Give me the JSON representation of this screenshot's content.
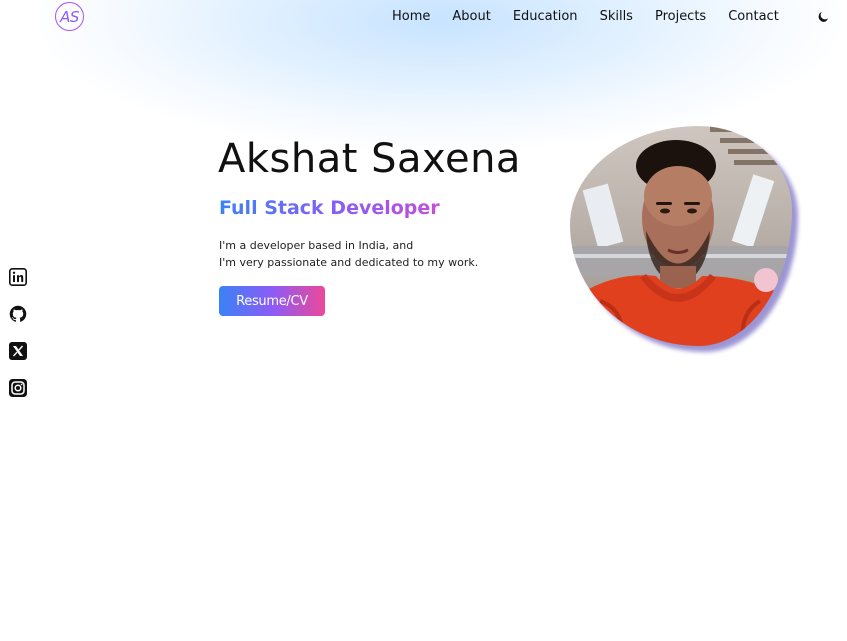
{
  "header": {
    "logo_text": "AS",
    "nav": [
      {
        "label": "Home"
      },
      {
        "label": "About"
      },
      {
        "label": "Education"
      },
      {
        "label": "Skills"
      },
      {
        "label": "Projects"
      },
      {
        "label": "Contact"
      }
    ],
    "theme_icon": "moon-icon"
  },
  "hero": {
    "name": "Akshat Saxena",
    "role": "Full Stack Developer",
    "intro_line1": "I'm a developer based in India, and",
    "intro_line2": "I'm very passionate and dedicated to my work.",
    "resume_label": "Resume/CV",
    "avatar_icon": "profile-photo"
  },
  "social": [
    {
      "icon": "linkedin-icon"
    },
    {
      "icon": "github-icon"
    },
    {
      "icon": "x-twitter-icon"
    },
    {
      "icon": "instagram-icon"
    }
  ],
  "colors": {
    "accent_blue": "#3b82f6",
    "accent_purple": "#8b5cf6",
    "accent_pink": "#ec4899"
  }
}
